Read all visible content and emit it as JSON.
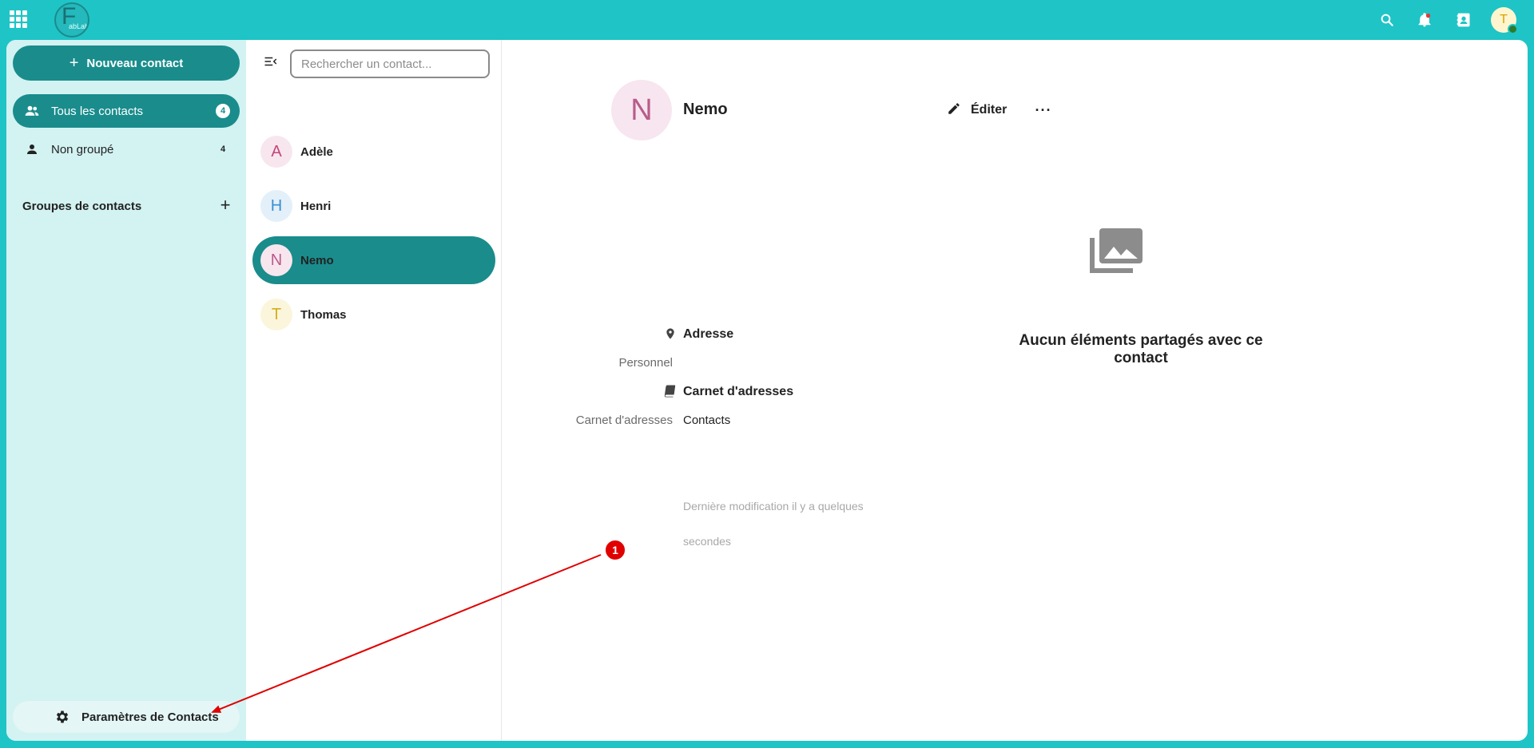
{
  "header": {
    "logo_text": "FabLab",
    "avatar_initial": "T"
  },
  "nav": {
    "new_contact_label": "Nouveau contact",
    "items": [
      {
        "label": "Tous les contacts",
        "count": "4"
      },
      {
        "label": "Non groupé",
        "count": "4"
      }
    ],
    "groups_title": "Groupes de contacts",
    "settings_label": "Paramètres de Contacts"
  },
  "list": {
    "search_placeholder": "Rechercher un contact...",
    "contacts": [
      {
        "initial": "A",
        "name": "Adèle"
      },
      {
        "initial": "H",
        "name": "Henri"
      },
      {
        "initial": "N",
        "name": "Nemo"
      },
      {
        "initial": "T",
        "name": "Thomas"
      }
    ]
  },
  "detail": {
    "initial": "N",
    "name": "Nemo",
    "edit_label": "Éditer",
    "empty_media_text": "Aucun éléments partagés avec ce contact",
    "address_title": "Adresse",
    "address_label": "Personnel",
    "addressbook_title": "Carnet d'adresses",
    "addressbook_label": "Carnet d'adresses",
    "addressbook_value": "Contacts",
    "last_modified_line1": "Dernière modification il y a quelques",
    "last_modified_line2": "secondes"
  },
  "annotation": {
    "step_number": "1"
  },
  "colors": {
    "accent": "#1fc4c6",
    "primary": "#1a8c8c",
    "nav_bg": "#d3f2f2",
    "annotation_red": "#e00000"
  }
}
